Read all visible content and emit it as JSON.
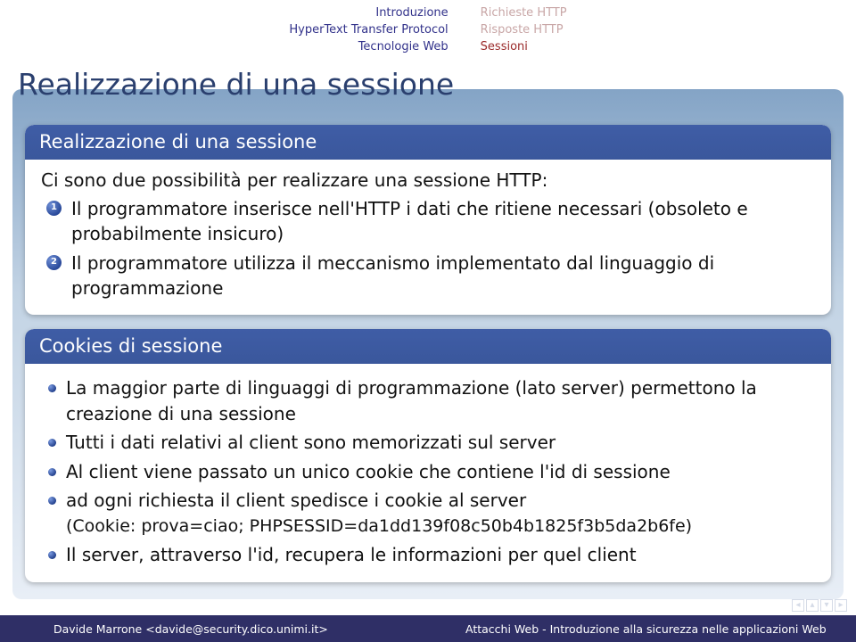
{
  "header": {
    "left": [
      "Introduzione",
      "HyperText Transfer Protocol",
      "Tecnologie Web"
    ],
    "right": [
      {
        "label": "Richieste HTTP",
        "active": false
      },
      {
        "label": "Risposte HTTP",
        "active": false
      },
      {
        "label": "Sessioni",
        "active": true
      }
    ]
  },
  "slide_title": "Realizzazione di una sessione",
  "block1": {
    "title": "Realizzazione di una sessione",
    "intro": "Ci sono due possibilità per realizzare una sessione HTTP:",
    "items": [
      "Il programmatore inserisce nell'HTTP i dati che ritiene necessari (obsoleto e probabilmente insicuro)",
      "Il programmatore utilizza il meccanismo implementato dal linguaggio di programmazione"
    ]
  },
  "block2": {
    "title": "Cookies di sessione",
    "items": [
      {
        "text": "La maggior parte di linguaggi di programmazione (lato server) permettono la creazione di una sessione"
      },
      {
        "text": "Tutti i dati relativi al client sono memorizzati sul server"
      },
      {
        "text": "Al client viene passato un unico cookie che contiene l'id di sessione"
      },
      {
        "text": "ad ogni richiesta il client spedisce i cookie al server",
        "sub": "(Cookie: prova=ciao; PHPSESSID=da1dd139f08c50b4b1825f3b5da2b6fe)"
      },
      {
        "text": "Il server, attraverso l'id, recupera le informazioni per quel client"
      }
    ]
  },
  "footer": {
    "left": "Davide Marrone <davide@security.dico.unimi.it>",
    "right": "Attacchi Web - Introduzione alla sicurezza nelle applicazioni Web"
  }
}
